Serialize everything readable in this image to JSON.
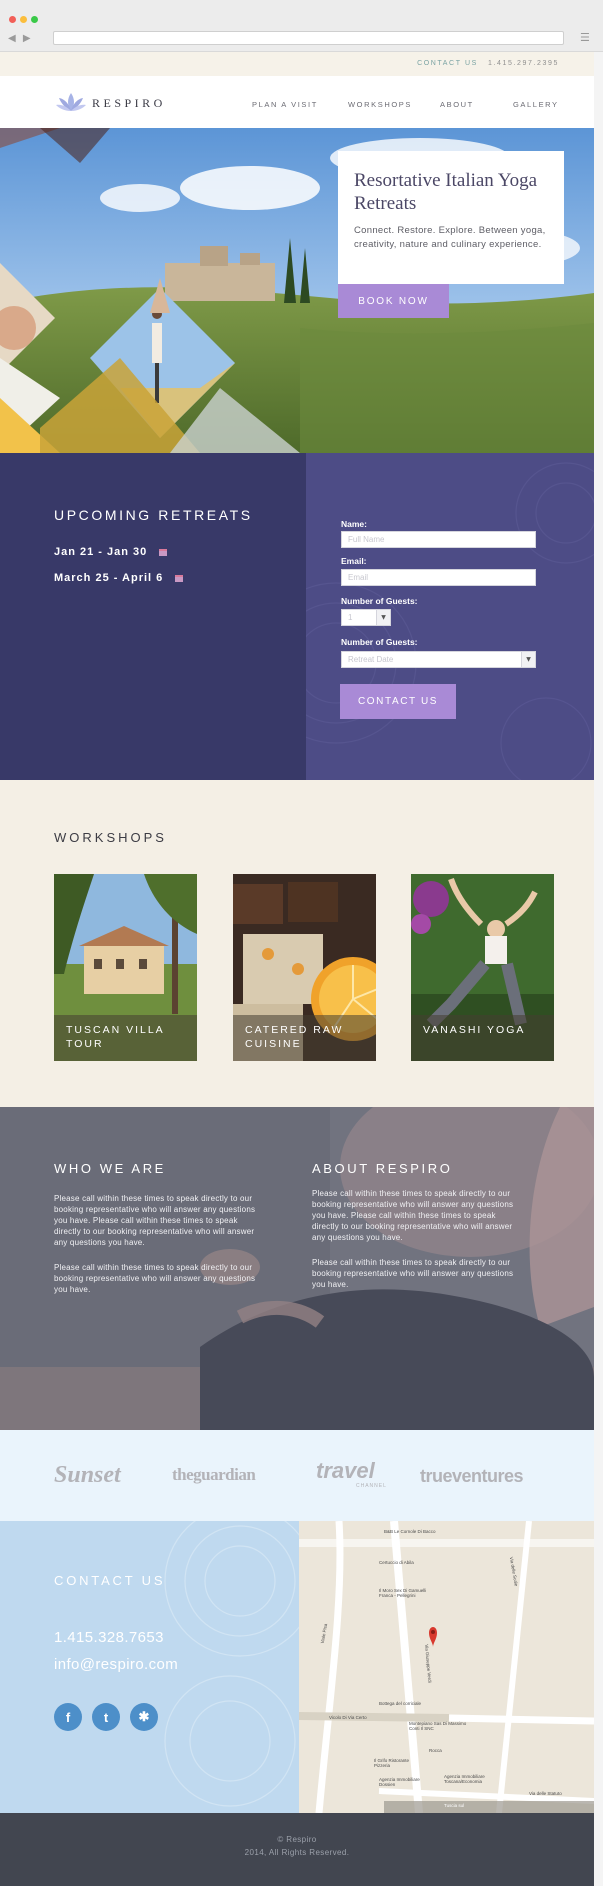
{
  "topbar": {
    "contact_label": "CONTACT US",
    "phone": "1.415.297.2395"
  },
  "header": {
    "logo_text": "RESPIRO",
    "nav": [
      "PLAN A VISIT",
      "WORKSHOPS",
      "ABOUT",
      "GALLERY"
    ]
  },
  "hero": {
    "title": "Resortative Italian Yoga Retreats",
    "body": "Connect. Restore. Explore. Between yoga, creativity, nature and culinary experience.",
    "button": "BOOK NOW"
  },
  "retreats": {
    "heading": "UPCOMING RETREATS",
    "dates": [
      "Jan 21 - Jan 30",
      "March 25 - April 6"
    ],
    "form": {
      "name_label": "Name:",
      "name_placeholder": "Full Name",
      "email_label": "Email:",
      "email_placeholder": "Email",
      "guests_label": "Number of Guests:",
      "guests_value": "1",
      "date_label": "Number of Guests:",
      "date_placeholder": "Retreat Date",
      "submit": "CONTACT US"
    }
  },
  "workshops": {
    "heading": "WORKSHOPS",
    "items": [
      {
        "title": "TUSCAN VILLA TOUR"
      },
      {
        "title": "CATERED RAW CUISINE"
      },
      {
        "title": "VANASHI YOGA"
      }
    ]
  },
  "about": {
    "who_heading": "WHO WE ARE",
    "who_p1": "Please call within these times to speak directly to our booking representative who will answer any questions you have. Please call within these times to speak directly to our booking representative who will answer any questions you have.",
    "who_p2": "Please call within these times to speak directly to our booking representative who will answer any questions you have.",
    "respiro_heading": "ABOUT RESPIRO",
    "respiro_p1": "Please call within these times to speak directly to our booking representative who will answer any questions you have. Please call within these times to speak directly to our booking representative who will answer any questions you have.",
    "respiro_p2": "Please call within these times to speak directly to our booking representative who will answer any questions you have."
  },
  "press": {
    "logos": [
      "Sunset",
      "theguardian",
      "travel",
      "CHANNEL",
      "trueventures"
    ]
  },
  "contact": {
    "heading": "CONTACT US",
    "phone": "1.415.328.7653",
    "email": "info@respiro.com",
    "social": [
      "facebook-icon",
      "twitter-icon",
      "yelp-icon"
    ]
  },
  "map": {
    "labels": [
      "B&B Le Cornole Di Bacco",
      "Certuccio di Abila",
      "Il Moro Sex Di Gamuelli Franca - Pellegrini",
      "Bottega del corriciale",
      "Montepiano Sas Di Massimo Conti Il SNC",
      "Rocca",
      "Il Grifo Ristorante Pizzeria",
      "Agenzia Immobiliare Toscana/Economia",
      "Agenzia Immobiliare Dossien",
      "Via delle Statuto",
      "Via delle Scale",
      "Viale Pisa",
      "Via Giuseppe Verdi",
      "Vicolo Di Via Certo",
      "Tuscia sul"
    ]
  },
  "footer": {
    "line1": "© Respiro",
    "line2": "2014, All Rights Reserved."
  },
  "colors": {
    "accent": "#a98ad6",
    "navy": "#383968",
    "purple": "#4d4c86",
    "cream": "#f4efe5",
    "sky": "#bfd9ef",
    "footer": "#424650"
  }
}
